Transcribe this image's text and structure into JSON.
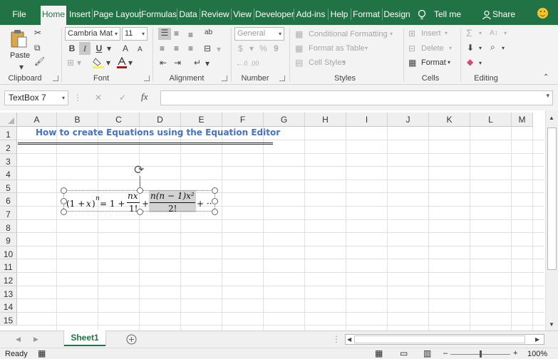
{
  "tabs": [
    {
      "label": "File",
      "active": false
    },
    {
      "label": "Home",
      "active": true
    },
    {
      "label": "Insert",
      "active": false
    },
    {
      "label": "Page Layout",
      "active": false
    },
    {
      "label": "Formulas",
      "active": false
    },
    {
      "label": "Data",
      "active": false
    },
    {
      "label": "Review",
      "active": false
    },
    {
      "label": "View",
      "active": false
    },
    {
      "label": "Developer",
      "active": false
    },
    {
      "label": "Add-ins",
      "active": false
    },
    {
      "label": "Help",
      "active": false
    },
    {
      "label": "Format",
      "active": false
    },
    {
      "label": "Design",
      "active": false
    }
  ],
  "tell_me": "Tell me",
  "share": "Share",
  "ribbon": {
    "clipboard": {
      "label": "Clipboard",
      "paste": "Paste"
    },
    "font": {
      "label": "Font",
      "name": "Cambria Mat",
      "size": "11",
      "bold": "B",
      "italic": "I",
      "underline": "U",
      "grow": "A",
      "shrink": "A"
    },
    "alignment": {
      "label": "Alignment"
    },
    "number": {
      "label": "Number",
      "format": "General",
      "currency": "$",
      "percent": "%",
      "comma": "9",
      "inc_decimal": "←.0",
      "dec_decimal": ".00"
    },
    "styles": {
      "label": "Styles",
      "conditional": "Conditional Formatting",
      "table": "Format as Table",
      "cell_styles": "Cell Styles"
    },
    "cells": {
      "label": "Cells",
      "insert": "Insert",
      "delete": "Delete",
      "format": "Format"
    },
    "editing": {
      "label": "Editing"
    }
  },
  "formula_bar": {
    "name_box": "TextBox 7",
    "fx": "fx",
    "value": ""
  },
  "columns": [
    "A",
    "B",
    "C",
    "D",
    "E",
    "F",
    "G",
    "H",
    "I",
    "J",
    "K",
    "L",
    "M"
  ],
  "rows": [
    "1",
    "2",
    "3",
    "4",
    "5",
    "6",
    "7",
    "8",
    "9",
    "10",
    "11",
    "12",
    "13",
    "14",
    "15"
  ],
  "cells": {
    "b1": "How to create Equations using the Equation Editor"
  },
  "equation": {
    "lhs_open": "(1 + ",
    "lhs_var": "x",
    "lhs_close": ")",
    "lhs_exp": "n",
    "eq_one": " = 1 +",
    "f1_num": "nx",
    "f1_den": "1!",
    "plus1": "+",
    "f2_num": "n(n − 1)x²",
    "f2_den": "2!",
    "plus2": "+ ··"
  },
  "sheet_tab": "Sheet1",
  "status": {
    "ready": "Ready",
    "zoom": "100%",
    "minus": "–",
    "plus": "+"
  }
}
